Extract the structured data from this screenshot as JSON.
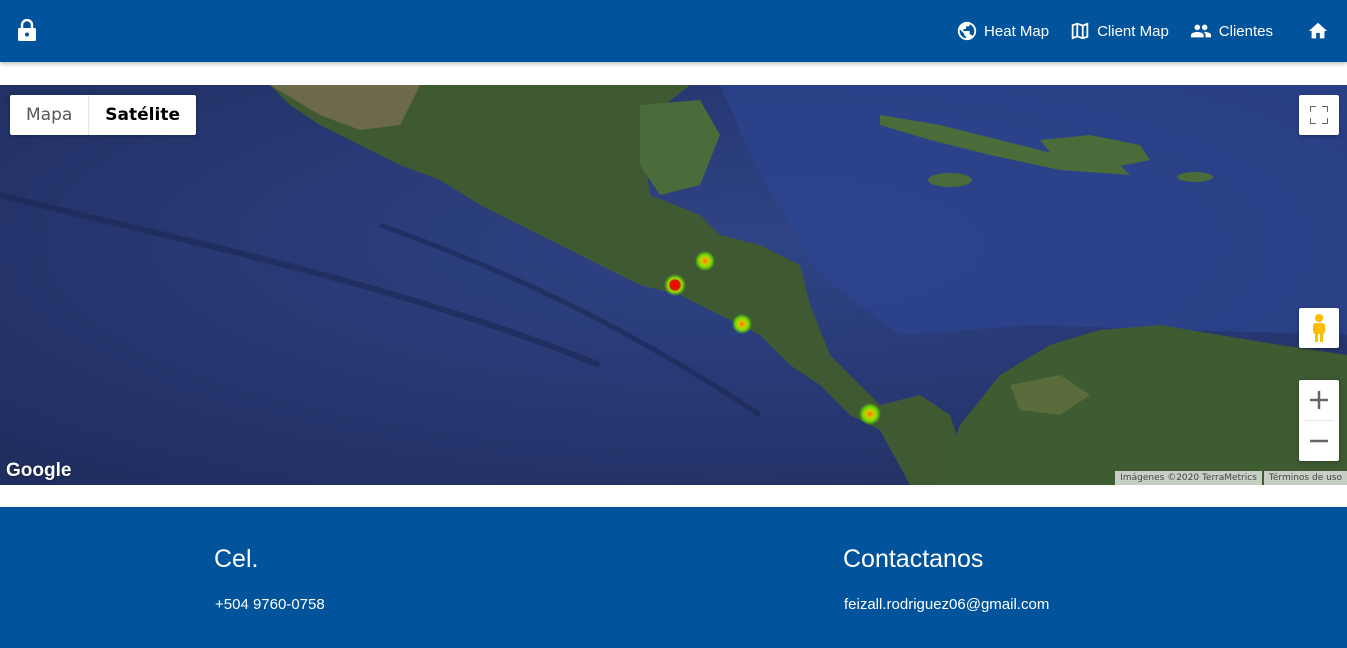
{
  "navbar": {
    "lock_icon": "lock-icon",
    "links": [
      {
        "label": "Heat Map",
        "icon": "globe-icon"
      },
      {
        "label": "Client Map",
        "icon": "map-icon"
      },
      {
        "label": "Clientes",
        "icon": "people-icon"
      }
    ],
    "home_icon": "home-icon",
    "background": "#01549c"
  },
  "map": {
    "type_options": [
      {
        "label": "Mapa",
        "selected": false
      },
      {
        "label": "Satélite",
        "selected": true
      }
    ],
    "logo": "Google",
    "attribution": "Imágenes ©2020 TerraMetrics",
    "terms": "Términos de uso",
    "controls": [
      "fullscreen-icon",
      "pegman-icon",
      "zoom-in-icon",
      "zoom-out-icon"
    ]
  },
  "footer": {
    "phone_title": "Cel.",
    "phone": "+504 9760-0758",
    "contact_title": "Contactanos",
    "email": "feizall.rodriguez06@gmail.com"
  }
}
